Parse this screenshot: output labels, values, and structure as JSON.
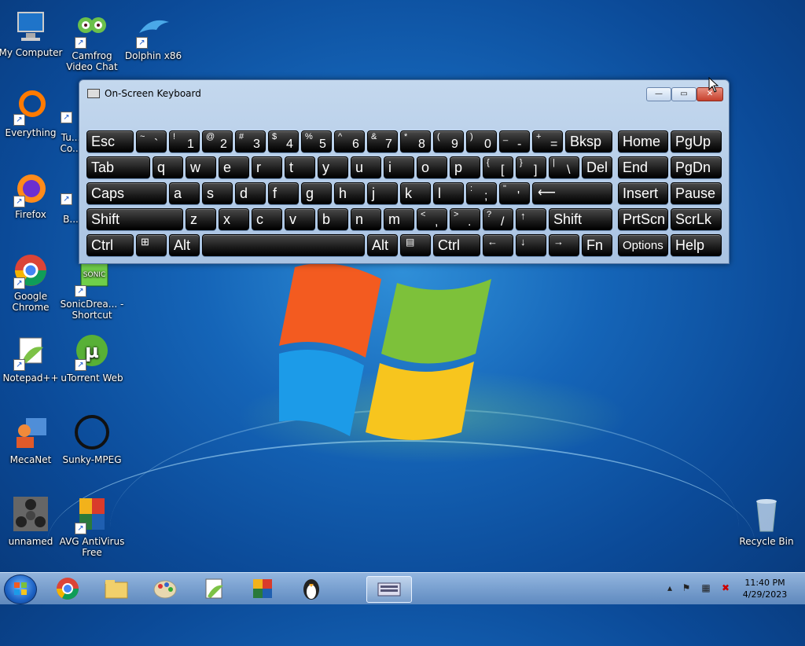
{
  "desktop": {
    "icons": [
      {
        "label": "My Computer"
      },
      {
        "label": "Camfrog Video Chat"
      },
      {
        "label": "Dolphin x86"
      },
      {
        "label": "Everything"
      },
      {
        "label": "Tu... Co..."
      },
      {
        "label": "Firefox"
      },
      {
        "label": "B..."
      },
      {
        "label": "Google Chrome"
      },
      {
        "label": "SonicDrea... - Shortcut"
      },
      {
        "label": "Notepad++"
      },
      {
        "label": "uTorrent Web"
      },
      {
        "label": "MecaNet"
      },
      {
        "label": "Sunky-MPEG"
      },
      {
        "label": "unnamed"
      },
      {
        "label": "AVG AntiVirus Free"
      },
      {
        "label": "Recycle Bin"
      }
    ]
  },
  "osk": {
    "title": "On-Screen Keyboard",
    "minimize": "—",
    "maximize": "▭",
    "close": "✕",
    "keys": {
      "esc": "Esc",
      "tab": "Tab",
      "caps": "Caps",
      "shift_l": "Shift",
      "ctrl_l": "Ctrl",
      "alt_l": "Alt",
      "bksp": "Bksp",
      "del": "Del",
      "shift_r": "Shift",
      "alt_r": "Alt",
      "ctrl_r": "Ctrl",
      "fn": "Fn",
      "home": "Home",
      "pgup": "PgUp",
      "end": "End",
      "pgdn": "PgDn",
      "insert": "Insert",
      "pause": "Pause",
      "prtscn": "PrtScn",
      "scrlk": "ScrLk",
      "options": "Options",
      "help": "Help",
      "q": "q",
      "w": "w",
      "e": "e",
      "r": "r",
      "t": "t",
      "y": "y",
      "u": "u",
      "i": "i",
      "o": "o",
      "p": "p",
      "a": "a",
      "s": "s",
      "d": "d",
      "f": "f",
      "g": "g",
      "h": "h",
      "j": "j",
      "k": "k",
      "l": "l",
      "z": "z",
      "x": "x",
      "c": "c",
      "v": "v",
      "b": "b",
      "n": "n",
      "m": "m",
      "up": "↑",
      "left": "←",
      "down": "↓",
      "right": "→"
    },
    "numrow": [
      {
        "s": "~",
        "c": "`"
      },
      {
        "s": "!",
        "c": "1"
      },
      {
        "s": "@",
        "c": "2"
      },
      {
        "s": "#",
        "c": "3"
      },
      {
        "s": "$",
        "c": "4"
      },
      {
        "s": "%",
        "c": "5"
      },
      {
        "s": "^",
        "c": "6"
      },
      {
        "s": "&",
        "c": "7"
      },
      {
        "s": "*",
        "c": "8"
      },
      {
        "s": "(",
        "c": "9"
      },
      {
        "s": ")",
        "c": "0"
      },
      {
        "s": "_",
        "c": "-"
      },
      {
        "s": "+",
        "c": "="
      }
    ],
    "punct": [
      {
        "s": "{",
        "c": "["
      },
      {
        "s": "}",
        "c": "]"
      },
      {
        "s": "|",
        "c": "\\"
      },
      {
        "s": ":",
        "c": ";"
      },
      {
        "s": "\"",
        "c": "'"
      },
      {
        "s": "<",
        "c": ","
      },
      {
        "s": ">",
        "c": "."
      },
      {
        "s": "?",
        "c": "/"
      }
    ]
  },
  "taskbar": {
    "clock_time": "11:40 PM",
    "clock_date": "4/29/2023"
  }
}
